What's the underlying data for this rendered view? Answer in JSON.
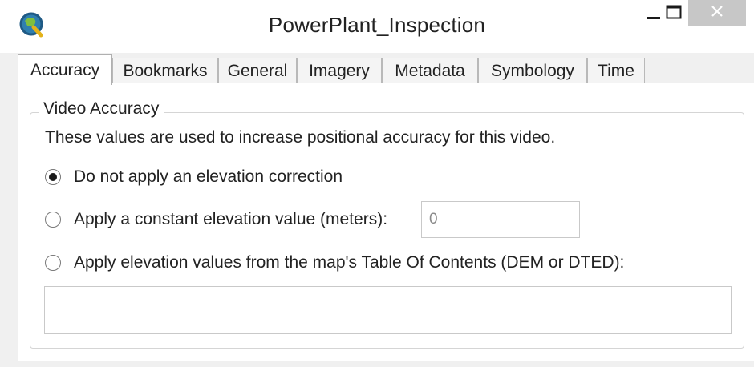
{
  "window": {
    "title": "PowerPlant_Inspection",
    "app_icon": "q-globe-icon",
    "controls": {
      "minimize": "minimize-icon",
      "maximize": "maximize-icon",
      "close": "close-icon"
    }
  },
  "tabs": [
    {
      "label": "Accuracy",
      "active": true
    },
    {
      "label": "Bookmarks",
      "active": false
    },
    {
      "label": "General",
      "active": false
    },
    {
      "label": "Imagery",
      "active": false
    },
    {
      "label": "Metadata",
      "active": false
    },
    {
      "label": "Symbology",
      "active": false
    },
    {
      "label": "Time",
      "active": false
    }
  ],
  "accuracy": {
    "group_title": "Video Accuracy",
    "description": "These values are used to increase positional accuracy for this video.",
    "options": [
      {
        "label": "Do not apply an elevation correction",
        "selected": true
      },
      {
        "label": "Apply a constant elevation value (meters):",
        "selected": false
      },
      {
        "label": "Apply elevation values from the map's Table Of Contents (DEM or DTED):",
        "selected": false
      }
    ],
    "constant_elevation_value": "0",
    "dem_source_value": ""
  },
  "colors": {
    "close_button_bg": "#c7c7c7",
    "window_bg": "#f0f0f0",
    "panel_bg": "#ffffff",
    "border": "#b9b9b9"
  }
}
